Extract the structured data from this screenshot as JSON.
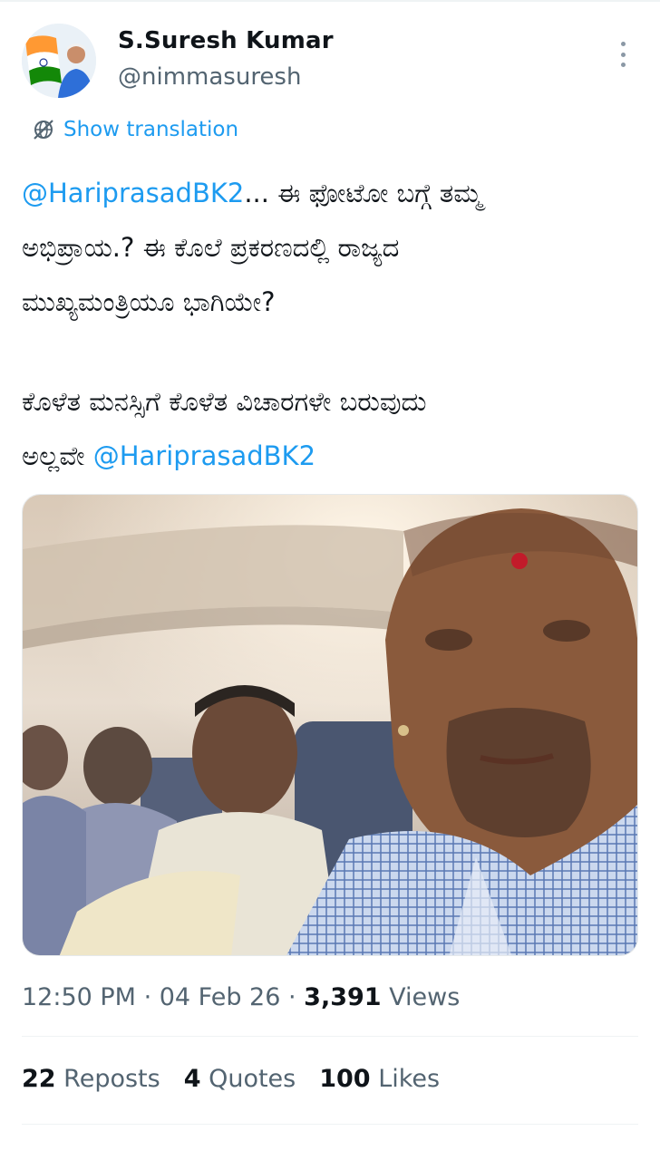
{
  "author": {
    "name": "S.Suresh Kumar",
    "handle": "@nimmasuresh"
  },
  "translate": {
    "label": "Show translation",
    "icon": "globe-slash-icon"
  },
  "tweet": {
    "mention1": "@HariprasadBK2",
    "line1_rest": "... ಈ ಫೋಟೋ ಬಗ್ಗೆ ತಮ್ಮ",
    "line2": "ಅಭಿಪ್ರಾಯ.? ಈ ಕೊಲೆ ಪ್ರಕರಣದಲ್ಲಿ ರಾಜ್ಯದ",
    "line3": "ಮುಖ್ಯಮಂತ್ರಿಯೂ ಭಾಗಿಯೇ?",
    "line4": " ಕೊಳೆತ ಮನಸ್ಸಿಗೆ ಕೊಳೆತ ವಿಚಾರಗಳೇ ಬರುವುದು",
    "line5_start": "ಅಲ್ಲವೇ ",
    "mention2": "@HariprasadBK2"
  },
  "meta": {
    "time": "12:50 PM",
    "sep1": " · ",
    "date": "04 Feb 26",
    "sep2": " · ",
    "views_count": "3,391",
    "views_label": " Views"
  },
  "stats": {
    "reposts_count": "22",
    "reposts_label": " Reposts",
    "quotes_count": "4",
    "quotes_label": " Quotes",
    "likes_count": "100",
    "likes_label": " Likes"
  },
  "colors": {
    "accent": "#1d9bf0",
    "muted": "#536471",
    "text": "#0f1419"
  }
}
